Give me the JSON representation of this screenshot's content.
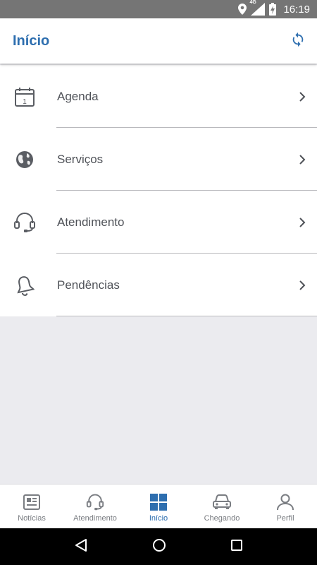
{
  "status_bar": {
    "time": "16:19",
    "network_label": "4G",
    "icons": [
      "location-icon",
      "signal-icon",
      "battery-charging-icon"
    ]
  },
  "app_bar": {
    "title": "Início",
    "action_icon": "refresh-icon"
  },
  "menu": {
    "items": [
      {
        "label": "Agenda",
        "icon": "calendar-icon",
        "calendar_day": "1"
      },
      {
        "label": "Serviços",
        "icon": "globe-icon"
      },
      {
        "label": "Atendimento",
        "icon": "headset-icon"
      },
      {
        "label": "Pendências",
        "icon": "bell-icon"
      }
    ]
  },
  "bottom_nav": {
    "items": [
      {
        "label": "Notícias",
        "icon": "newspaper-icon",
        "active": false
      },
      {
        "label": "Atendimento",
        "icon": "headset-icon",
        "active": false
      },
      {
        "label": "Início",
        "icon": "grid-icon",
        "active": true
      },
      {
        "label": "Chegando",
        "icon": "car-icon",
        "active": false
      },
      {
        "label": "Perfil",
        "icon": "person-icon",
        "active": false
      }
    ]
  },
  "colors": {
    "accent": "#2d6eaf",
    "text": "#4f5258",
    "background": "#ebebef",
    "status_bar": "#757575"
  }
}
